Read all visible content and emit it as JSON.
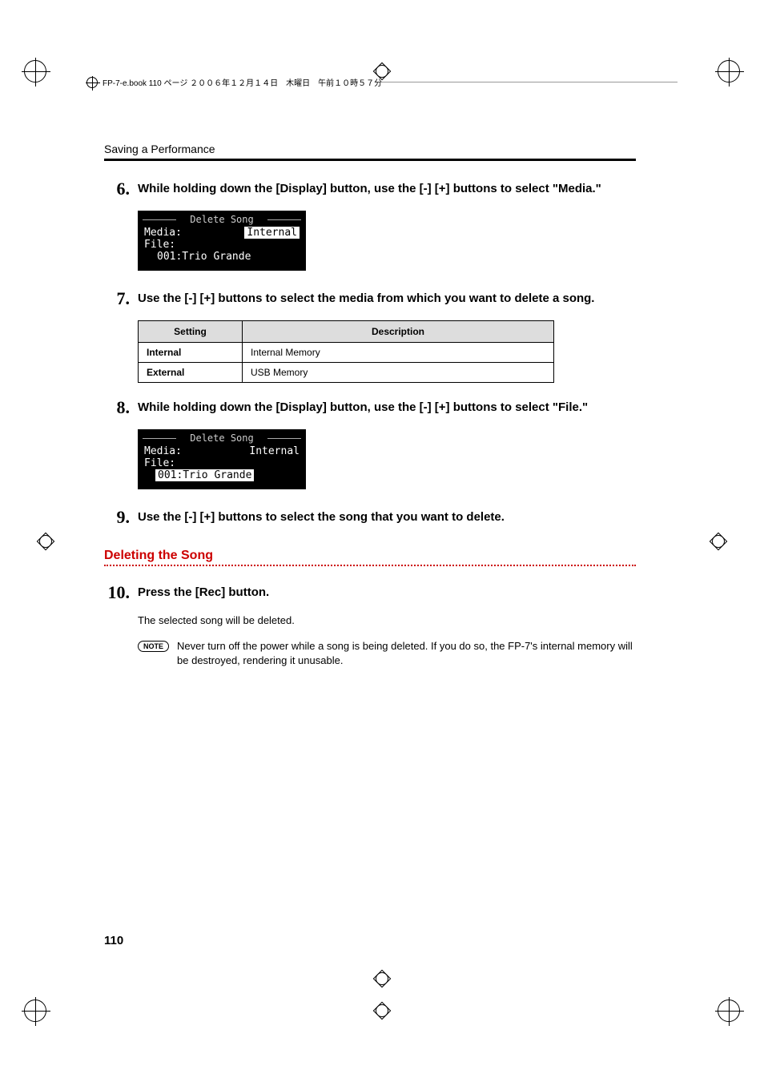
{
  "header": {
    "meta_text": "FP-7-e.book  110 ページ  ２００６年１２月１４日　木曜日　午前１０時５７分"
  },
  "section_title": "Saving a Performance",
  "steps": {
    "s6": {
      "num": "6.",
      "text": "While holding down the [Display] button, use the [-] [+] buttons to select \"Media.\""
    },
    "s7": {
      "num": "7.",
      "text": "Use the [-] [+] buttons to select the media from which you want to delete a song."
    },
    "s8": {
      "num": "8.",
      "text": "While holding down the [Display] button, use the [-] [+] buttons to select \"File.\""
    },
    "s9": {
      "num": "9.",
      "text": "Use the [-] [+] buttons to select the song that you want to delete."
    },
    "s10": {
      "num": "10.",
      "text": "Press the [Rec] button."
    }
  },
  "lcd1": {
    "title": "Delete Song",
    "media_label": "Media:",
    "media_val": "Internal",
    "file_label": "File:",
    "file_val": "001:Trio Grande"
  },
  "lcd2": {
    "title": "Delete Song",
    "media_label": "Media:",
    "media_val": "Internal",
    "file_label": "File:",
    "file_val": "001:Trio Grande"
  },
  "table": {
    "header_setting": "Setting",
    "header_description": "Description",
    "rows": [
      {
        "setting": "Internal",
        "description": "Internal Memory"
      },
      {
        "setting": "External",
        "description": "USB Memory"
      }
    ]
  },
  "subsection": "Deleting the Song",
  "step10_desc": "The selected song will be deleted.",
  "note": {
    "badge": "NOTE",
    "text": "Never turn off the power while a song is being deleted. If you do so, the FP-7's internal memory will be destroyed, rendering it unusable."
  },
  "page_number": "110"
}
